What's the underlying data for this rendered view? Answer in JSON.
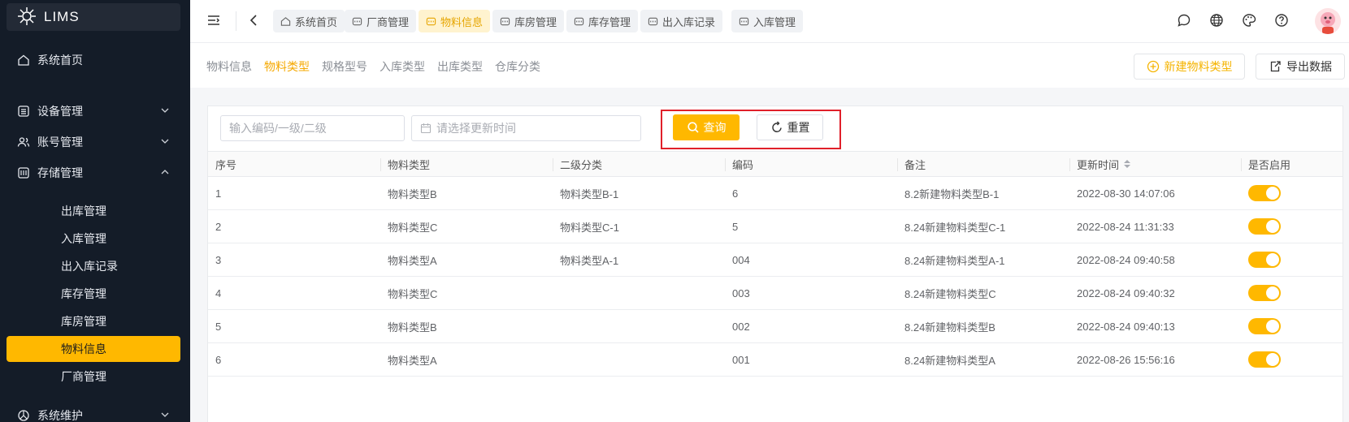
{
  "app": {
    "name": "LIMS"
  },
  "sidebar": {
    "home": "系统首页",
    "groups": [
      {
        "label": "设备管理",
        "icon": "list-icon",
        "expanded": false
      },
      {
        "label": "账号管理",
        "icon": "users-icon",
        "expanded": false
      },
      {
        "label": "存储管理",
        "icon": "storage-icon",
        "expanded": true
      }
    ],
    "storage_items": [
      "出库管理",
      "入库管理",
      "出入库记录",
      "库存管理",
      "库房管理",
      "物料信息",
      "厂商管理"
    ],
    "active_item": "物料信息",
    "bottom_group": "系统维护"
  },
  "header": {
    "tabs": [
      {
        "label": "系统首页",
        "icon": "home-icon"
      },
      {
        "label": "厂商管理",
        "icon": "tab-icon"
      },
      {
        "label": "物料信息",
        "icon": "tab-icon",
        "active": true
      },
      {
        "label": "库房管理",
        "icon": "tab-icon"
      },
      {
        "label": "库存管理",
        "icon": "tab-icon"
      },
      {
        "label": "出入库记录",
        "icon": "tab-icon"
      },
      {
        "label": "入库管理",
        "icon": "tab-icon"
      }
    ],
    "right_icons": [
      "chat-icon",
      "globe-icon",
      "palette-icon",
      "help-icon"
    ]
  },
  "subtabs": {
    "items": [
      "物料信息",
      "物料类型",
      "规格型号",
      "入库类型",
      "出库类型",
      "仓库分类"
    ],
    "active": "物料类型"
  },
  "actions": {
    "new_label": "新建物料类型",
    "export_label": "导出数据"
  },
  "filters": {
    "code_placeholder": "输入编码/一级/二级",
    "date_placeholder": "请选择更新时间",
    "query_label": "查询",
    "reset_label": "重置"
  },
  "table": {
    "headers": [
      "序号",
      "物料类型",
      "二级分类",
      "编码",
      "备注",
      "更新时间",
      "是否启用"
    ],
    "rows": [
      [
        "1",
        "物料类型B",
        "物料类型B-1",
        "6",
        "8.2新建物料类型B-1",
        "2022-08-30 14:07:06"
      ],
      [
        "2",
        "物料类型C",
        "物料类型C-1",
        "5",
        "8.24新建物料类型C-1",
        "2022-08-24 11:31:33"
      ],
      [
        "3",
        "物料类型A",
        "物料类型A-1",
        "004",
        "8.24新建物料类型A-1",
        "2022-08-24 09:40:58"
      ],
      [
        "4",
        "物料类型C",
        "",
        "003",
        "8.24新建物料类型C",
        "2022-08-24 09:40:32"
      ],
      [
        "5",
        "物料类型B",
        "",
        "002",
        "8.24新建物料类型B",
        "2022-08-24 09:40:13"
      ],
      [
        "6",
        "物料类型A",
        "",
        "001",
        "8.24新建物料类型A",
        "2022-08-26 15:56:16"
      ]
    ],
    "enabled": [
      true,
      true,
      true,
      true,
      true,
      true
    ]
  },
  "colors": {
    "accent": "#ffb800",
    "sidebar_bg": "#141c28",
    "highlight": "#e0202a"
  }
}
